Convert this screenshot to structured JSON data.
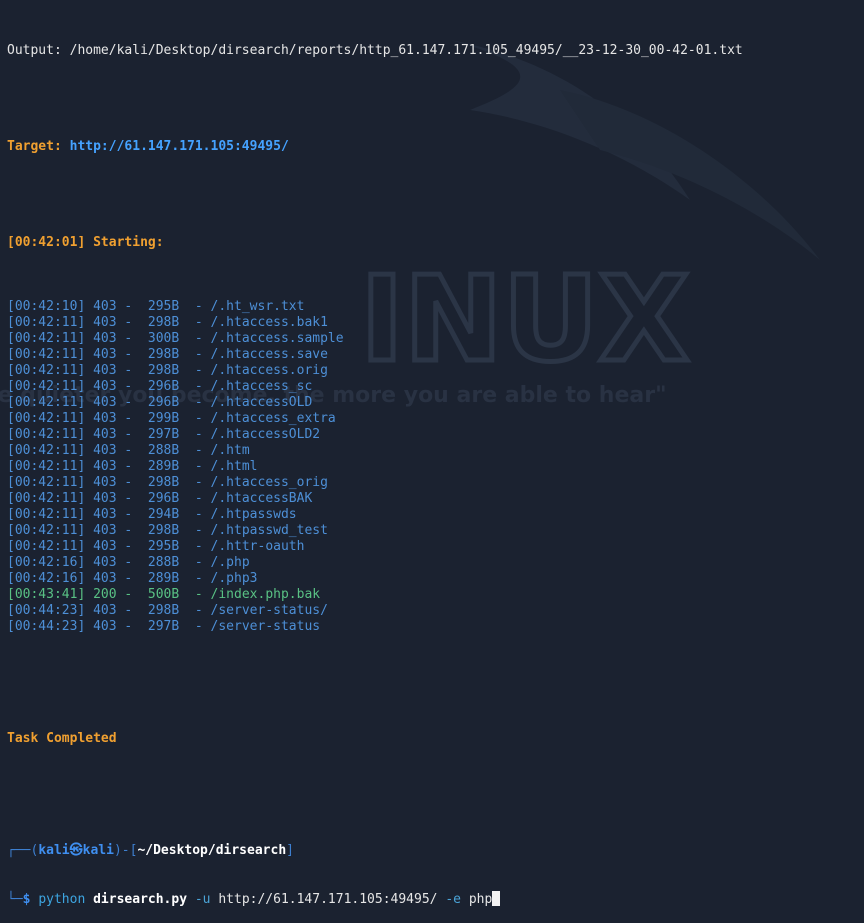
{
  "output": {
    "label": "Output:",
    "path": "/home/kali/Desktop/dirsearch/reports/http_61.147.171.105_49495/__23-12-30_00-42-01.txt"
  },
  "target": {
    "label": "Target:",
    "url": "http://61.147.171.105:49495/"
  },
  "starting": {
    "time": "[00:42:01]",
    "label": "Starting:"
  },
  "results": [
    {
      "time": "[00:42:10]",
      "status": "403",
      "size": "295B",
      "path": "/.ht_wsr.txt"
    },
    {
      "time": "[00:42:11]",
      "status": "403",
      "size": "298B",
      "path": "/.htaccess.bak1"
    },
    {
      "time": "[00:42:11]",
      "status": "403",
      "size": "300B",
      "path": "/.htaccess.sample"
    },
    {
      "time": "[00:42:11]",
      "status": "403",
      "size": "298B",
      "path": "/.htaccess.save"
    },
    {
      "time": "[00:42:11]",
      "status": "403",
      "size": "298B",
      "path": "/.htaccess.orig"
    },
    {
      "time": "[00:42:11]",
      "status": "403",
      "size": "296B",
      "path": "/.htaccess_sc"
    },
    {
      "time": "[00:42:11]",
      "status": "403",
      "size": "296B",
      "path": "/.htaccessOLD"
    },
    {
      "time": "[00:42:11]",
      "status": "403",
      "size": "299B",
      "path": "/.htaccess_extra"
    },
    {
      "time": "[00:42:11]",
      "status": "403",
      "size": "297B",
      "path": "/.htaccessOLD2"
    },
    {
      "time": "[00:42:11]",
      "status": "403",
      "size": "288B",
      "path": "/.htm"
    },
    {
      "time": "[00:42:11]",
      "status": "403",
      "size": "289B",
      "path": "/.html"
    },
    {
      "time": "[00:42:11]",
      "status": "403",
      "size": "298B",
      "path": "/.htaccess_orig"
    },
    {
      "time": "[00:42:11]",
      "status": "403",
      "size": "296B",
      "path": "/.htaccessBAK"
    },
    {
      "time": "[00:42:11]",
      "status": "403",
      "size": "294B",
      "path": "/.htpasswds"
    },
    {
      "time": "[00:42:11]",
      "status": "403",
      "size": "298B",
      "path": "/.htpasswd_test"
    },
    {
      "time": "[00:42:11]",
      "status": "403",
      "size": "295B",
      "path": "/.httr-oauth"
    },
    {
      "time": "[00:42:16]",
      "status": "403",
      "size": "288B",
      "path": "/.php"
    },
    {
      "time": "[00:42:16]",
      "status": "403",
      "size": "289B",
      "path": "/.php3"
    },
    {
      "time": "[00:43:41]",
      "status": "200",
      "size": "500B",
      "path": "/index.php.bak"
    },
    {
      "time": "[00:44:23]",
      "status": "403",
      "size": "298B",
      "path": "/server-status/"
    },
    {
      "time": "[00:44:23]",
      "status": "403",
      "size": "297B",
      "path": "/server-status"
    }
  ],
  "task_completed": "Task Completed",
  "prompt": {
    "top_left": "┌──(",
    "user": "kali",
    "at": "㉿",
    "host": "kali",
    "mid": ")-[",
    "path": "~/Desktop/dirsearch",
    "end": "]",
    "bottom_left": "└─",
    "dollar": "$"
  },
  "command": {
    "program": "python",
    "script": "dirsearch.py",
    "flag_u": "-u",
    "url": "http://61.147.171.105:49495/",
    "flag_e": "-e",
    "ext": "php"
  },
  "wallpaper": {
    "word": "INUX",
    "tagline": "\"the quieter you become, the more you are able to hear\""
  },
  "colors": {
    "background": "#1b2230",
    "orange": "#f0a030",
    "blue_403": "#4d8fd6",
    "green_200": "#59c184"
  }
}
